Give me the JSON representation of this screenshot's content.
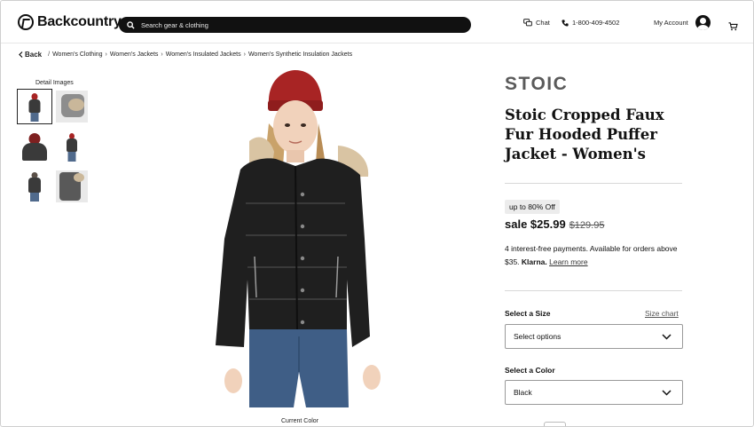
{
  "header": {
    "logo_text": "Backcountry",
    "search_placeholder": "Search gear & clothing",
    "chat_label": "Chat",
    "phone": "1-800-409-4502",
    "account_label": "My Account"
  },
  "breadcrumb": {
    "back_label": "Back",
    "items": [
      "Women's Clothing",
      "Women's Jackets",
      "Women's Insulated Jackets",
      "Women's Synthetic Insulation Jackets"
    ]
  },
  "gallery": {
    "detail_label": "Detail Images",
    "current_color_label": "Current Color"
  },
  "product": {
    "brand": "STOIC",
    "title": "Stoic Cropped Faux Fur Hooded Puffer Jacket - Women's",
    "discount_badge": "up to 80% Off",
    "sale_price": "sale $25.99",
    "original_price": "$129.95",
    "payments_text": "4 interest-free payments. Available for orders above $35.",
    "payments_brand": "Klarna.",
    "learn_more": "Learn more"
  },
  "options": {
    "size_label": "Select a Size",
    "size_chart": "Size chart",
    "size_value": "Select options",
    "color_label": "Select a Color",
    "color_value": "Black"
  },
  "colors": {
    "jacket": "#1f1f1f",
    "beanie": "#a82424",
    "denim": "#3f5e86",
    "fur": "#d9c4a3"
  }
}
